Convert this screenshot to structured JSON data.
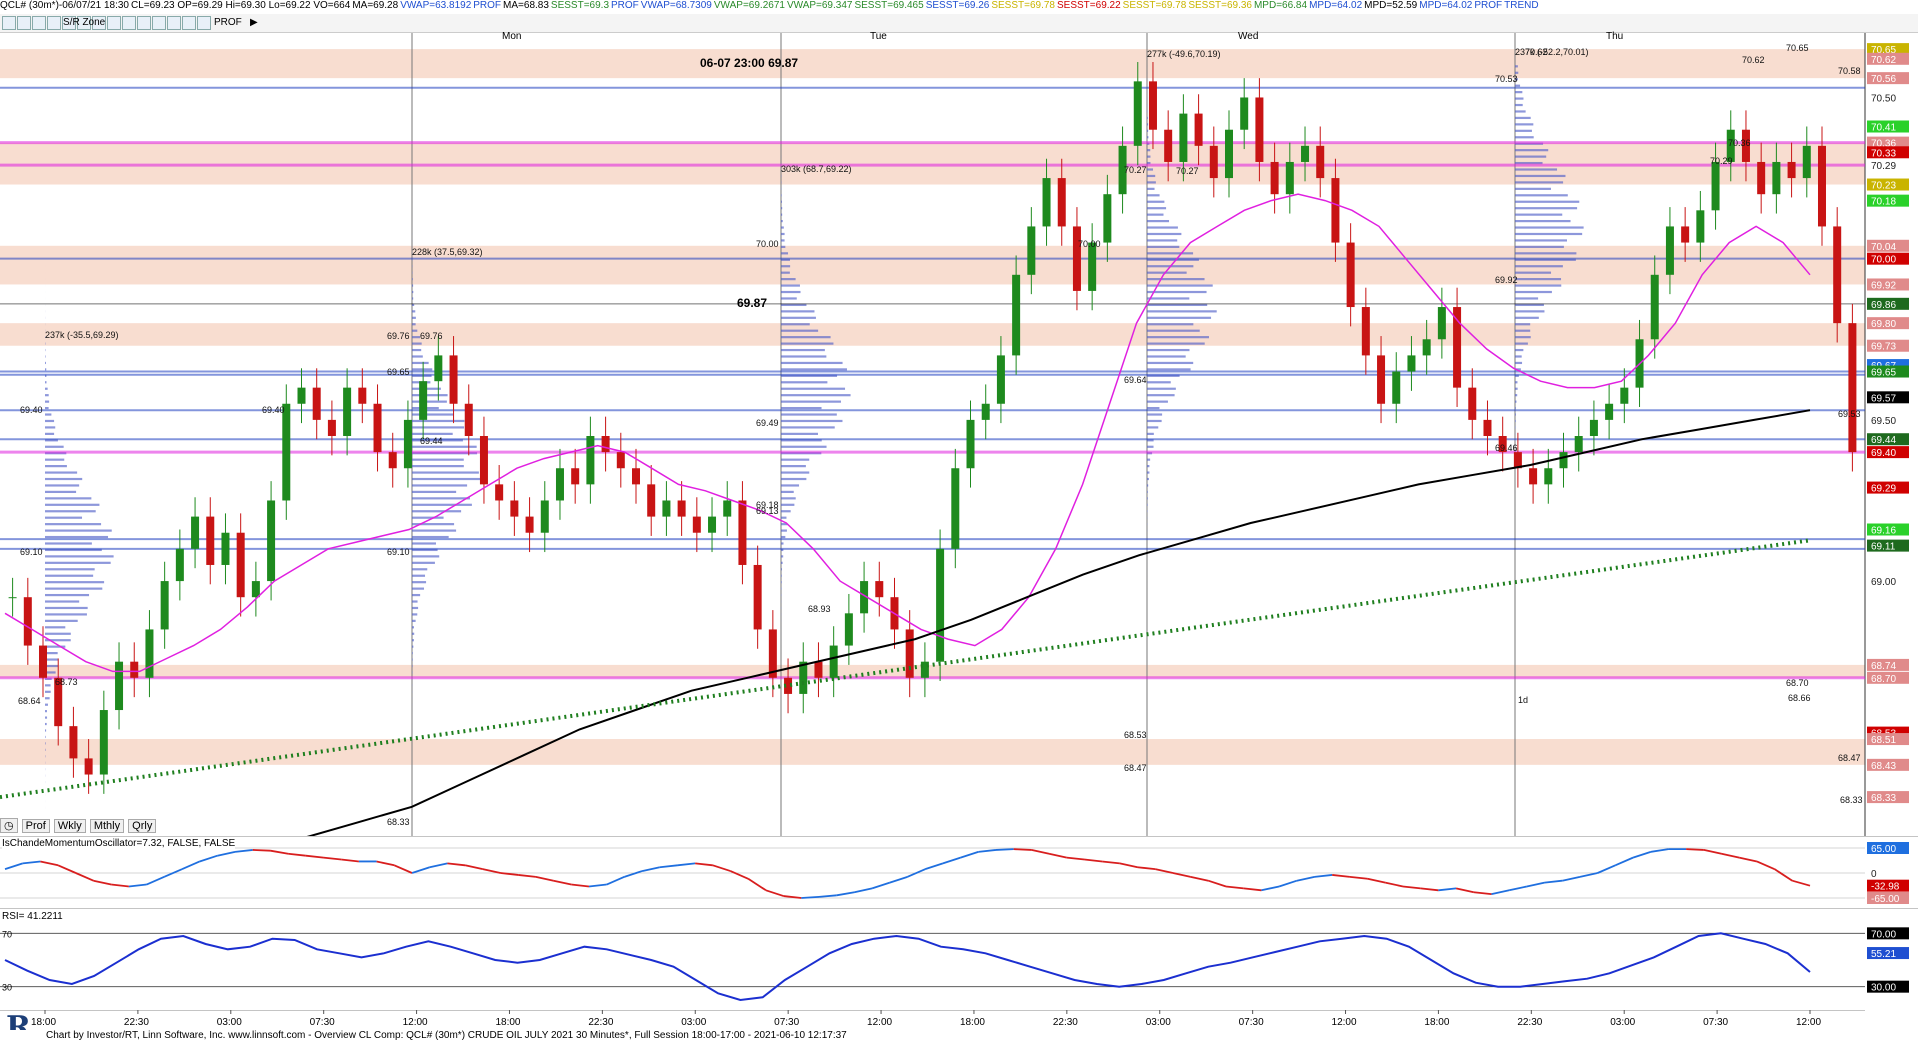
{
  "infobar": {
    "symbol": "QCL# (30m*)-06/07/21 18:30",
    "ohlc": "CL=69.23 OP=69.29 Hi=69.30 Lo=69.22 VO=664",
    "indicators": [
      {
        "label": "MA=69.28",
        "color": "#000000"
      },
      {
        "label": "VWAP=63.8192",
        "color": "#1f4fd1"
      },
      {
        "label": "PROF",
        "color": "#1f4fd1"
      },
      {
        "label": "MA=68.83",
        "color": "#000000"
      },
      {
        "label": "SESST=69.3",
        "color": "#2a8a2a"
      },
      {
        "label": "PROF",
        "color": "#1f4fd1"
      },
      {
        "label": "VWAP=68.7309",
        "color": "#1f4fd1"
      },
      {
        "label": "VWAP=69.2671",
        "color": "#2a8a2a"
      },
      {
        "label": "VWAP=69.347",
        "color": "#2a8a2a"
      },
      {
        "label": "SESST=69.465",
        "color": "#2a8a2a"
      },
      {
        "label": "SESST=69.26",
        "color": "#1f4fd1"
      },
      {
        "label": "SESST=69.78",
        "color": "#c9b400"
      },
      {
        "label": "SESST=69.22",
        "color": "#d00000"
      },
      {
        "label": "SESST=69.78",
        "color": "#c9b400"
      },
      {
        "label": "SESST=69.36",
        "color": "#c9b400"
      },
      {
        "label": "MPD=66.84",
        "color": "#2a8a2a"
      },
      {
        "label": "MPD=64.02",
        "color": "#1f4fd1"
      },
      {
        "label": "MPD=52.59",
        "color": "#000000"
      },
      {
        "label": "MPD=64.02",
        "color": "#1f4fd1"
      },
      {
        "label": "PROF",
        "color": "#1f4fd1"
      },
      {
        "label": "TREND",
        "color": "#1f4fd1"
      }
    ]
  },
  "toolbar": {
    "prof_label": "PROF",
    "sr_zone_label": "S/R Zone"
  },
  "days": [
    "Mon",
    "Tue",
    "Wed",
    "Thu"
  ],
  "annotations": {
    "top_label": "06-07 23:00",
    "top_value": "69.87",
    "mid_value": "69.87"
  },
  "bottom_tabs": [
    "Prof",
    "Wkly",
    "Mthly",
    "Qrly"
  ],
  "cmo_label": "IsChandeMomentumOscillator=7.32, FALSE, FALSE",
  "rsi_label": "RSI= 41.2211",
  "footer": "Chart by Investor/RT, Linn Software, Inc. www.linnsoft.com - Overview  CL  Comp: QCL# (30m*) CRUDE OIL JULY 2021 30 Minutes*, Full Session 18:00-17:00 - 2021-06-10 12:17:37",
  "colors": {
    "up": "#1e8a1e",
    "down": "#c81414",
    "zone": "#f7d7c8",
    "vwap": "#e020e0",
    "ma200": "#000000",
    "profile": "#5060c8",
    "poc": "#1f3fc0",
    "cmo_up": "#1f6fdf",
    "cmo_down": "#d81e1e",
    "rsi": "#1b2fd0"
  },
  "chart_data": [
    {
      "type": "line",
      "title": "QCL# (30m*) CRUDE OIL JULY 2021 30 Minutes*",
      "x_tick_labels": [
        "18:00",
        "22:30",
        "03:00",
        "07:30",
        "12:00",
        "18:00",
        "22:30",
        "03:00",
        "07:30",
        "12:00",
        "18:00",
        "22:30",
        "03:00",
        "07:30",
        "12:00",
        "18:00",
        "22:30",
        "03:00",
        "07:30",
        "12:00"
      ],
      "session_labels": [
        "Mon",
        "Tue",
        "Wed",
        "Thu"
      ],
      "ylim": [
        68.2,
        70.7
      ],
      "y_tick_labels": [
        "70.50",
        "70.00",
        "69.50",
        "69.00"
      ],
      "series": [
        {
          "name": "close",
          "values": [
            68.95,
            68.8,
            68.7,
            68.55,
            68.45,
            68.4,
            68.6,
            68.75,
            68.7,
            68.85,
            69.0,
            69.1,
            69.2,
            69.05,
            69.15,
            68.95,
            69.0,
            69.25,
            69.55,
            69.6,
            69.5,
            69.45,
            69.6,
            69.55,
            69.4,
            69.35,
            69.5,
            69.62,
            69.7,
            69.55,
            69.45,
            69.3,
            69.25,
            69.2,
            69.15,
            69.25,
            69.35,
            69.3,
            69.45,
            69.4,
            69.35,
            69.3,
            69.2,
            69.25,
            69.2,
            69.15,
            69.2,
            69.25,
            69.05,
            68.85,
            68.7,
            68.65,
            68.75,
            68.7,
            68.8,
            68.9,
            69.0,
            68.95,
            68.85,
            68.7,
            68.75,
            69.1,
            69.35,
            69.5,
            69.55,
            69.7,
            69.95,
            70.1,
            70.25,
            70.1,
            69.9,
            70.05,
            70.2,
            70.35,
            70.55,
            70.4,
            70.3,
            70.45,
            70.35,
            70.25,
            70.4,
            70.5,
            70.3,
            70.2,
            70.3,
            70.35,
            70.25,
            70.05,
            69.85,
            69.7,
            69.55,
            69.65,
            69.7,
            69.75,
            69.85,
            69.6,
            69.5,
            69.45,
            69.4,
            69.35,
            69.3,
            69.35,
            69.4,
            69.45,
            69.5,
            69.55,
            69.6,
            69.75,
            69.95,
            70.1,
            70.05,
            70.15,
            70.3,
            70.4,
            70.3,
            70.2,
            70.3,
            70.25,
            70.35,
            70.1,
            69.8,
            69.4
          ]
        },
        {
          "name": "VWAP",
          "values": [
            68.9,
            68.85,
            68.8,
            68.75,
            68.72,
            68.72,
            68.76,
            68.8,
            68.85,
            68.92,
            69.0,
            69.05,
            69.1,
            69.12,
            69.14,
            69.16,
            69.2,
            69.25,
            69.3,
            69.35,
            69.38,
            69.4,
            69.42,
            69.4,
            69.35,
            69.3,
            69.28,
            69.25,
            69.22,
            69.18,
            69.1,
            69.0,
            68.95,
            68.9,
            68.85,
            68.82,
            68.8,
            68.85,
            68.95,
            69.1,
            69.3,
            69.55,
            69.8,
            69.95,
            70.05,
            70.1,
            70.15,
            70.18,
            70.2,
            70.18,
            70.15,
            70.1,
            70.0,
            69.9,
            69.8,
            69.72,
            69.66,
            69.62,
            69.6,
            69.6,
            69.62,
            69.7,
            69.8,
            69.95,
            70.05,
            70.1,
            70.05,
            69.95
          ]
        },
        {
          "name": "MA",
          "values": [
            68.2,
            68.25,
            68.3,
            68.38,
            68.46,
            68.54,
            68.6,
            68.66,
            68.7,
            68.74,
            68.78,
            68.82,
            68.88,
            68.95,
            69.02,
            69.08,
            69.13,
            69.18,
            69.22,
            69.26,
            69.3,
            69.33,
            69.36,
            69.4,
            69.44,
            69.47,
            69.5,
            69.53
          ]
        }
      ],
      "price_levels": [
        "70.65",
        "70.62",
        "70.56",
        "70.50",
        "70.41",
        "70.36",
        "70.33",
        "70.29",
        "70.23",
        "70.18",
        "70.04",
        "70.00",
        "69.92",
        "69.86",
        "69.80",
        "69.73",
        "69.67",
        "69.65",
        "69.57",
        "69.50",
        "69.44",
        "69.40",
        "69.29",
        "69.16",
        "69.11",
        "69.00",
        "68.74",
        "68.70",
        "68.53",
        "68.51",
        "68.43",
        "68.33"
      ],
      "chart_labels": [
        "237k (-35.5,69.29)",
        "228k (37.5,69.32)",
        "303k (68.7,69.22)",
        "277k (-49.6,70.19)",
        "237k (-52.2,70.01)",
        "69.40",
        "69.40",
        "69.10",
        "69.10",
        "68.64",
        "68.73",
        "69.76",
        "69.76",
        "69.65",
        "69.44",
        "69.49",
        "69.13",
        "69.18",
        "68.93",
        "68.33",
        "70.00",
        "70.00",
        "70.27",
        "70.27",
        "69.64",
        "68.53",
        "68.47",
        "70.62",
        "70.53",
        "69.92",
        "69.46",
        "70.65",
        "70.62",
        "70.36",
        "70.29",
        "70.58",
        "69.53",
        "68.70",
        "68.66",
        "68.47",
        "68.33",
        "1d"
      ],
      "xlabel": "",
      "ylabel": ""
    },
    {
      "type": "line",
      "title": "IsChandeMomentumOscillator=7.32, FALSE, FALSE",
      "ylim": [
        -65,
        65
      ],
      "y_tick_labels": [
        "65.00",
        "0",
        "-32.98",
        "-65.00"
      ],
      "series": [
        {
          "name": "CMO",
          "values": [
            10,
            25,
            30,
            20,
            0,
            -20,
            -30,
            -35,
            -30,
            -10,
            10,
            30,
            45,
            55,
            60,
            58,
            50,
            45,
            40,
            35,
            30,
            30,
            20,
            0,
            15,
            25,
            20,
            10,
            0,
            -5,
            -10,
            -20,
            -30,
            -35,
            -30,
            -10,
            5,
            15,
            20,
            25,
            20,
            5,
            -15,
            -45,
            -60,
            -65,
            -62,
            -58,
            -50,
            -40,
            -25,
            -10,
            10,
            25,
            40,
            55,
            60,
            62,
            60,
            50,
            40,
            35,
            30,
            25,
            15,
            10,
            0,
            -10,
            -20,
            -35,
            -40,
            -45,
            -35,
            -20,
            -10,
            -5,
            -10,
            -15,
            -25,
            -35,
            -40,
            -45,
            -40,
            -50,
            -55,
            -45,
            -35,
            -25,
            -20,
            -10,
            0,
            20,
            40,
            55,
            62,
            62,
            60,
            50,
            40,
            30,
            10,
            -20,
            -33
          ]
        }
      ]
    },
    {
      "type": "line",
      "title": "RSI= 41.2211",
      "ylim": [
        20,
        80
      ],
      "y_tick_labels": [
        "70.00",
        "55.21",
        "30.00"
      ],
      "series": [
        {
          "name": "RSI",
          "values": [
            50,
            42,
            35,
            32,
            38,
            48,
            58,
            66,
            68,
            62,
            58,
            60,
            66,
            65,
            58,
            55,
            52,
            55,
            60,
            64,
            60,
            55,
            50,
            48,
            50,
            55,
            60,
            58,
            54,
            50,
            45,
            35,
            25,
            20,
            22,
            35,
            45,
            55,
            62,
            66,
            68,
            66,
            60,
            58,
            55,
            50,
            45,
            40,
            35,
            32,
            30,
            32,
            35,
            40,
            45,
            48,
            52,
            56,
            60,
            64,
            66,
            68,
            66,
            60,
            50,
            40,
            33,
            30,
            30,
            32,
            34,
            36,
            40,
            46,
            52,
            60,
            68,
            70,
            66,
            62,
            55,
            41
          ]
        }
      ]
    }
  ]
}
